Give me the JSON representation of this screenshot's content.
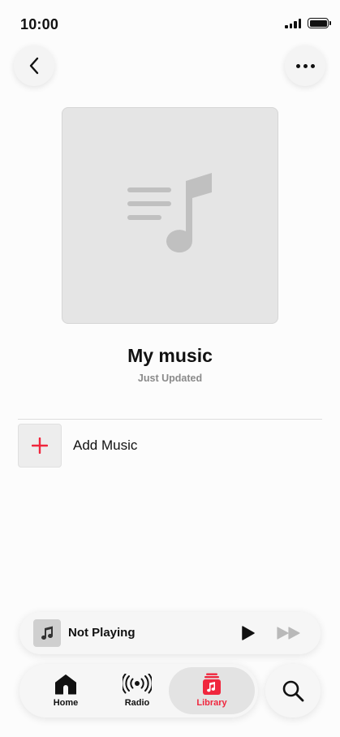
{
  "status_bar": {
    "time": "10:00"
  },
  "header": {
    "back_icon": "chevron-left-icon",
    "more_icon": "ellipsis-icon"
  },
  "playlist": {
    "title": "My music",
    "subtitle": "Just Updated",
    "artwork_icon": "playlist-note-icon"
  },
  "add_music": {
    "label": "Add Music",
    "icon": "plus-icon"
  },
  "mini_player": {
    "title": "Not Playing",
    "play_icon": "play-icon",
    "forward_icon": "fast-forward-icon"
  },
  "tabs": [
    {
      "label": "Home",
      "icon": "home-icon",
      "selected": false
    },
    {
      "label": "Radio",
      "icon": "radio-icon",
      "selected": false
    },
    {
      "label": "Library",
      "icon": "library-icon",
      "selected": true
    }
  ],
  "search": {
    "icon": "search-icon"
  },
  "colors": {
    "accent": "#f0263d",
    "background": "#fcfcfc",
    "artwork_bg": "#e5e5e5",
    "artwork_glyph": "#c0c0c0"
  }
}
